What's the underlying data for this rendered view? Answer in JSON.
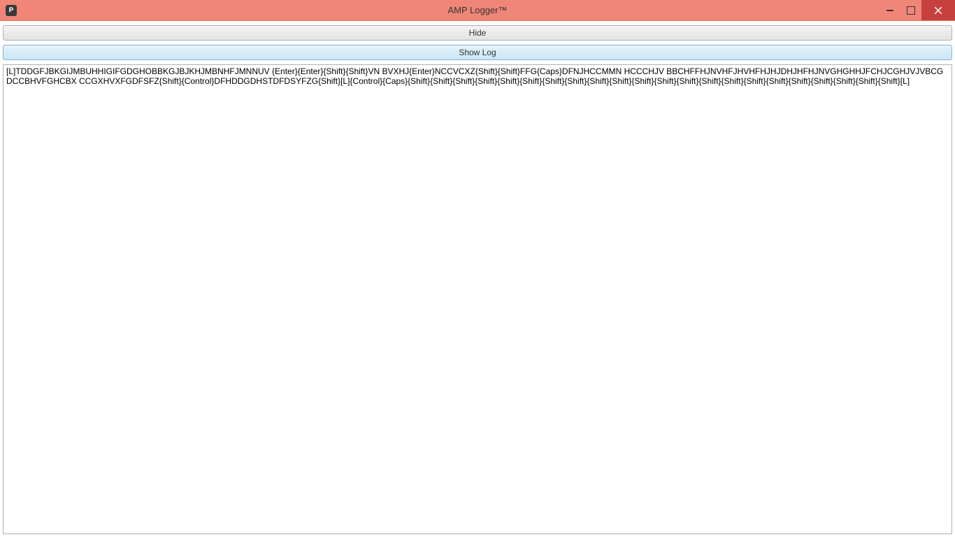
{
  "window": {
    "title": "AMP Logger™",
    "icon": "app-icon"
  },
  "buttons": {
    "hide_label": "Hide",
    "show_log_label": "Show Log"
  },
  "log": {
    "content": "[L]TDDGFJBKGIJMBUHHIGIFGDGHOBBKGJBJKHJMBNHFJMNNUV {Enter}{Enter}{Shift}{Shift}VN BVXHJ{Enter}NCCVCXZ{Shift}{Shift}FFG{Caps}DFNJHCCMMN  HCCCHJV  BBCHFFHJNVHFJHVHFHJHJDHJHFHJNVGHGHHJFCHJCGHJVJVBCGDCCBHVFGHCBX CCGXHVXFGDFSFZ{Shift}{Control}DFHDDGDHSTDFDSYFZG{Shift}[L]{Control}{Caps}{Shift}{Shift}{Shift}{Shift}{Shift}{Shift}{Shift}{Shift}{Shift}{Shift}{Shift}{Shift}{Shift}{Shift}{Shift}{Shift}{Shift}{Shift}{Shift}{Shift}{Shift}{Shift}[L]"
  }
}
